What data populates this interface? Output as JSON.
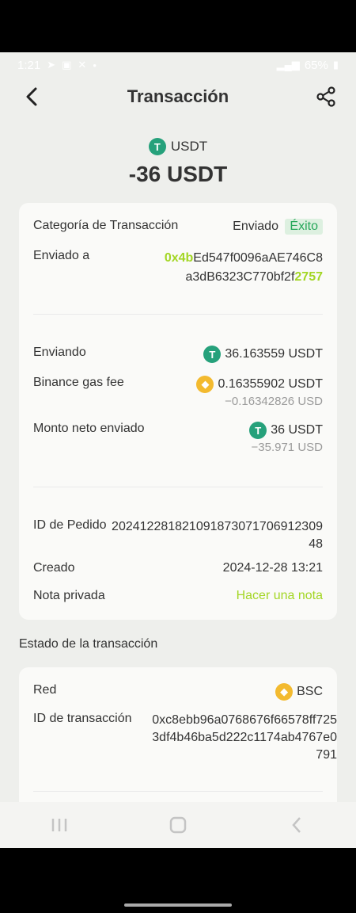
{
  "status": {
    "time": "1:21",
    "battery": "65%"
  },
  "header": {
    "title": "Transacción"
  },
  "asset": {
    "symbol": "USDT",
    "amount": "-36 USDT"
  },
  "details": {
    "category_label": "Categoría de Transacción",
    "category_value": "Enviado",
    "status_badge": "Éxito",
    "sent_to_label": "Enviado a",
    "address_prefix": "0x4b",
    "address_mid": "Ed547f0096aAE746C8",
    "address_line2": "a3dB6323C770bf2f",
    "address_suffix": "2757",
    "sending_label": "Enviando",
    "sending_value": "36.163559 USDT",
    "gas_label": "Binance gas fee",
    "gas_value": "0.16355902 USDT",
    "gas_usd": "−0.16342826 USD",
    "net_label": "Monto neto enviado",
    "net_value": "36 USDT",
    "net_usd": "−35.971 USD",
    "order_label": "ID de Pedido",
    "order_value_1": "202412281821091873071706912309",
    "order_value_2": "48",
    "created_label": "Creado",
    "created_value": "2024-12-28 13:21",
    "note_label": "Nota privada",
    "note_action": "Hacer una nota"
  },
  "state": {
    "title": "Estado de la transacción",
    "network_label": "Red",
    "network_value": "BSC",
    "txid_label": "ID de transacción",
    "txid_1": "0xc8ebb96a0768676f66578ff725",
    "txid_2": "3df4b46ba5d222c1174ab4767e0",
    "txid_3": "791"
  },
  "colors": {
    "accent": "#a3d624",
    "usdt": "#26a17b",
    "bnb": "#f3ba2f",
    "success_bg": "#ddf0e0",
    "success_text": "#27a75a"
  }
}
